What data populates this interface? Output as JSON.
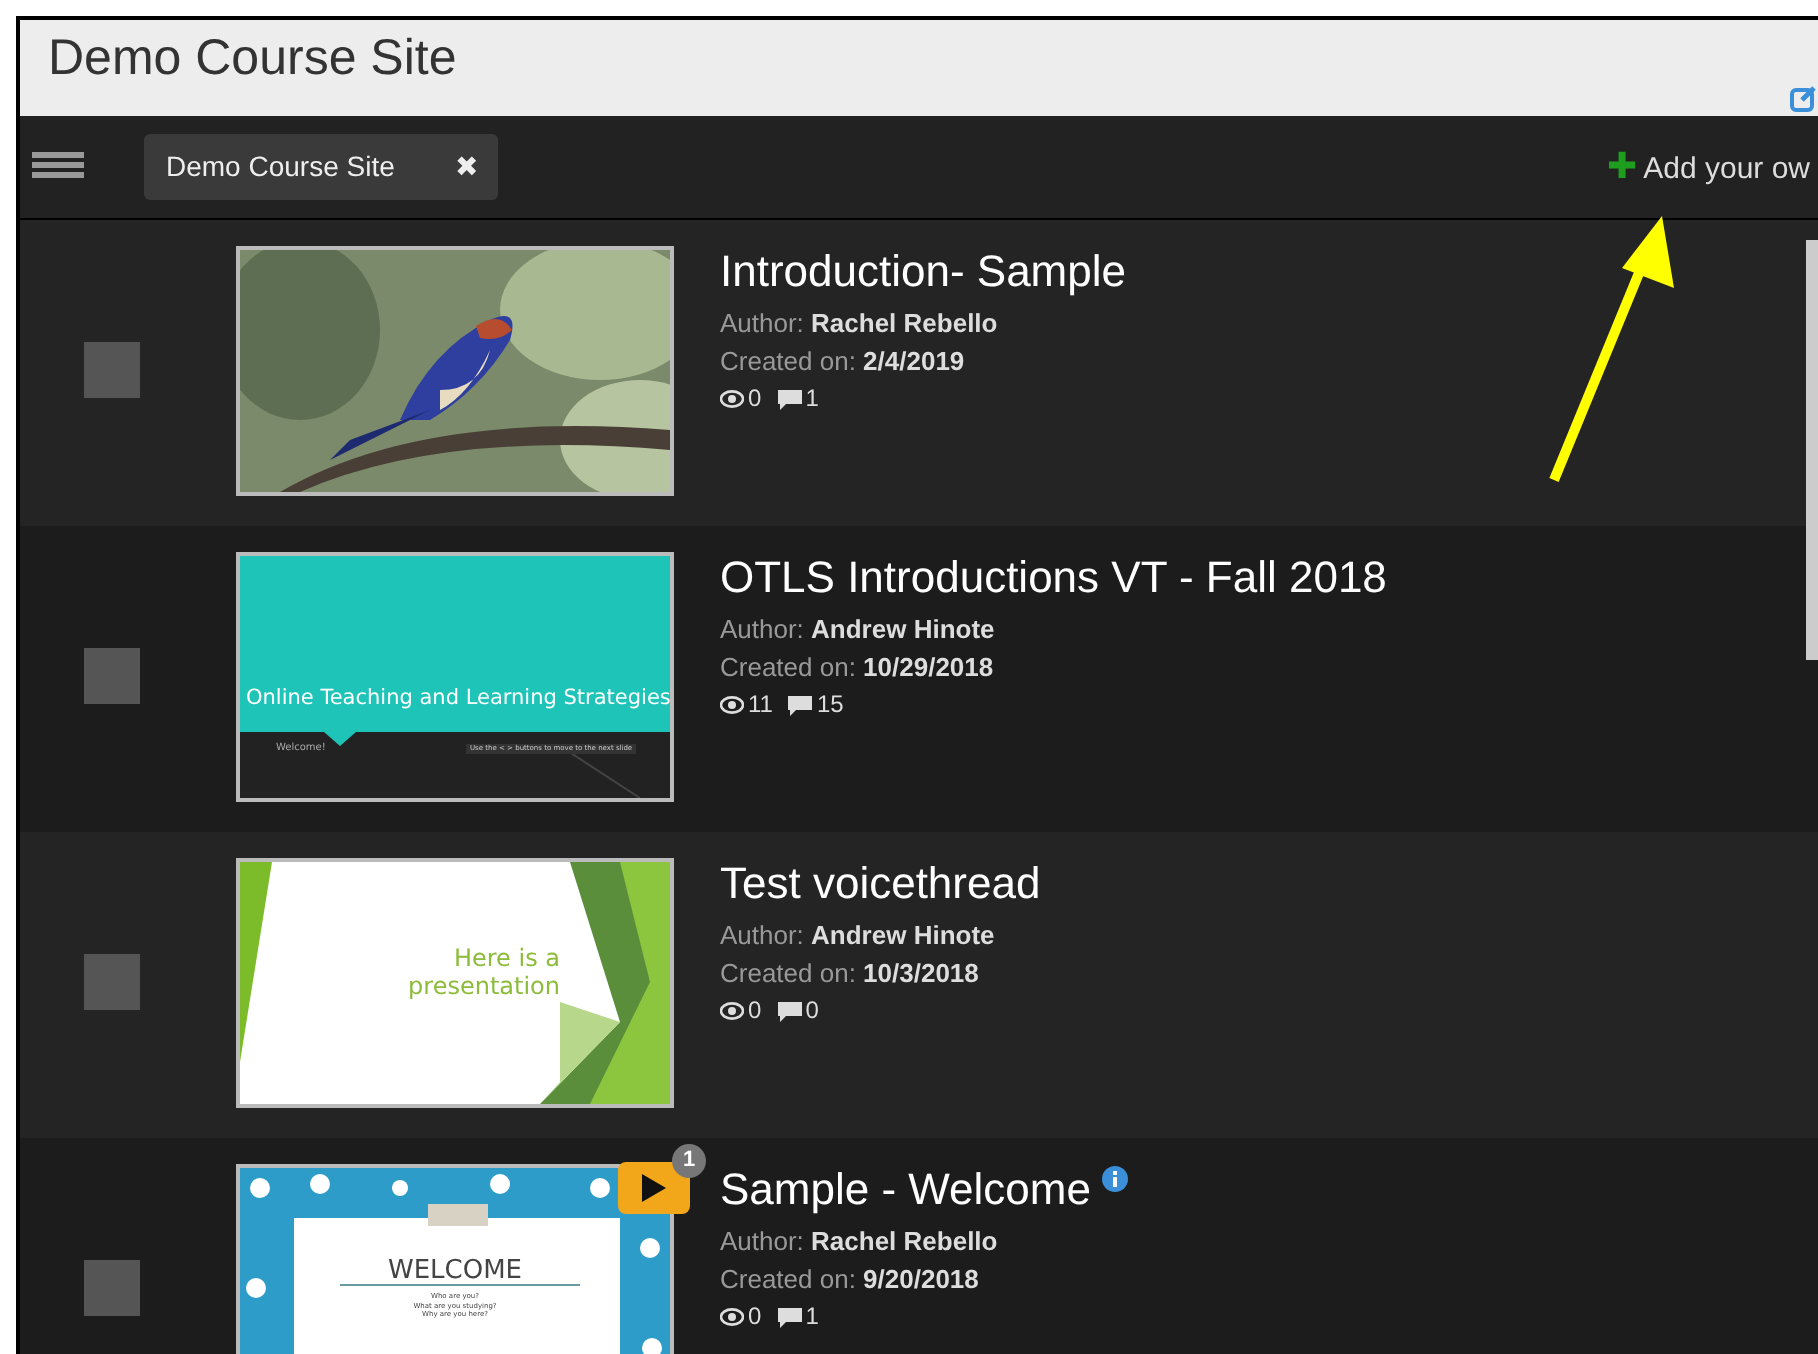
{
  "header": {
    "title": "Demo Course Site"
  },
  "toolbar": {
    "filter_tag": {
      "label": "Demo Course Site",
      "close": "✖"
    },
    "add_button": {
      "icon": "✚",
      "label": "Add your ow"
    }
  },
  "threads": [
    {
      "title": "Introduction- Sample",
      "author_label": "Author:",
      "author": "Rachel Rebello",
      "created_label": "Created on:",
      "created": "2/4/2019",
      "views": "0",
      "comments": "1",
      "checked": false,
      "info": false
    },
    {
      "title": "OTLS Introductions VT - Fall 2018",
      "author_label": "Author:",
      "author": "Andrew Hinote",
      "created_label": "Created on:",
      "created": "10/29/2018",
      "views": "11",
      "comments": "15",
      "checked": false,
      "info": false,
      "thumbnail": {
        "kind": "teal",
        "heading": "Online Teaching and Learning Strategies",
        "subtitle": "Welcome!",
        "note": "Use the < > buttons to move to the next slide"
      }
    },
    {
      "title": "Test voicethread",
      "author_label": "Author:",
      "author": "Andrew Hinote",
      "created_label": "Created on:",
      "created": "10/3/2018",
      "views": "0",
      "comments": "0",
      "checked": false,
      "info": false,
      "thumbnail": {
        "kind": "green",
        "heading": "Here is a presentation"
      }
    },
    {
      "title": "Sample - Welcome",
      "author_label": "Author:",
      "author": "Rachel Rebello",
      "created_label": "Created on:",
      "created": "9/20/2018",
      "views": "0",
      "comments": "1",
      "checked": false,
      "info": true,
      "badge": "1",
      "thumbnail": {
        "kind": "welcome",
        "heading": "WELCOME",
        "lines": [
          "Who are you?",
          "What are you studying?",
          "Why are you here?"
        ]
      }
    }
  ]
}
